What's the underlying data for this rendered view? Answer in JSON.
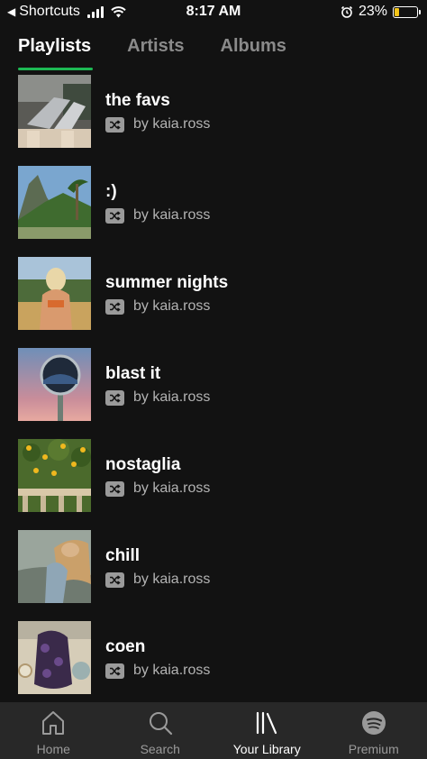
{
  "status_bar": {
    "back_app": "Shortcuts",
    "time": "8:17 AM",
    "battery": "23%",
    "battery_level": 0.23
  },
  "tabs": [
    {
      "label": "Playlists",
      "active": true
    },
    {
      "label": "Artists",
      "active": false
    },
    {
      "label": "Albums",
      "active": false
    }
  ],
  "playlists": [
    {
      "title": "the favs",
      "byline": "by kaia.ross"
    },
    {
      "title": ":)",
      "byline": "by kaia.ross"
    },
    {
      "title": "summer nights",
      "byline": "by kaia.ross"
    },
    {
      "title": "blast it",
      "byline": "by kaia.ross"
    },
    {
      "title": "nostaglia",
      "byline": "by kaia.ross"
    },
    {
      "title": "chill",
      "byline": "by kaia.ross"
    },
    {
      "title": "coen",
      "byline": "by kaia.ross"
    }
  ],
  "nav": [
    {
      "label": "Home",
      "icon": "home-icon"
    },
    {
      "label": "Search",
      "icon": "search-icon"
    },
    {
      "label": "Your Library",
      "icon": "library-icon"
    },
    {
      "label": "Premium",
      "icon": "spotify-icon"
    }
  ],
  "colors": {
    "background": "#121212",
    "accent": "#1db954",
    "nav_background": "#282828",
    "battery": "#f5c518"
  }
}
